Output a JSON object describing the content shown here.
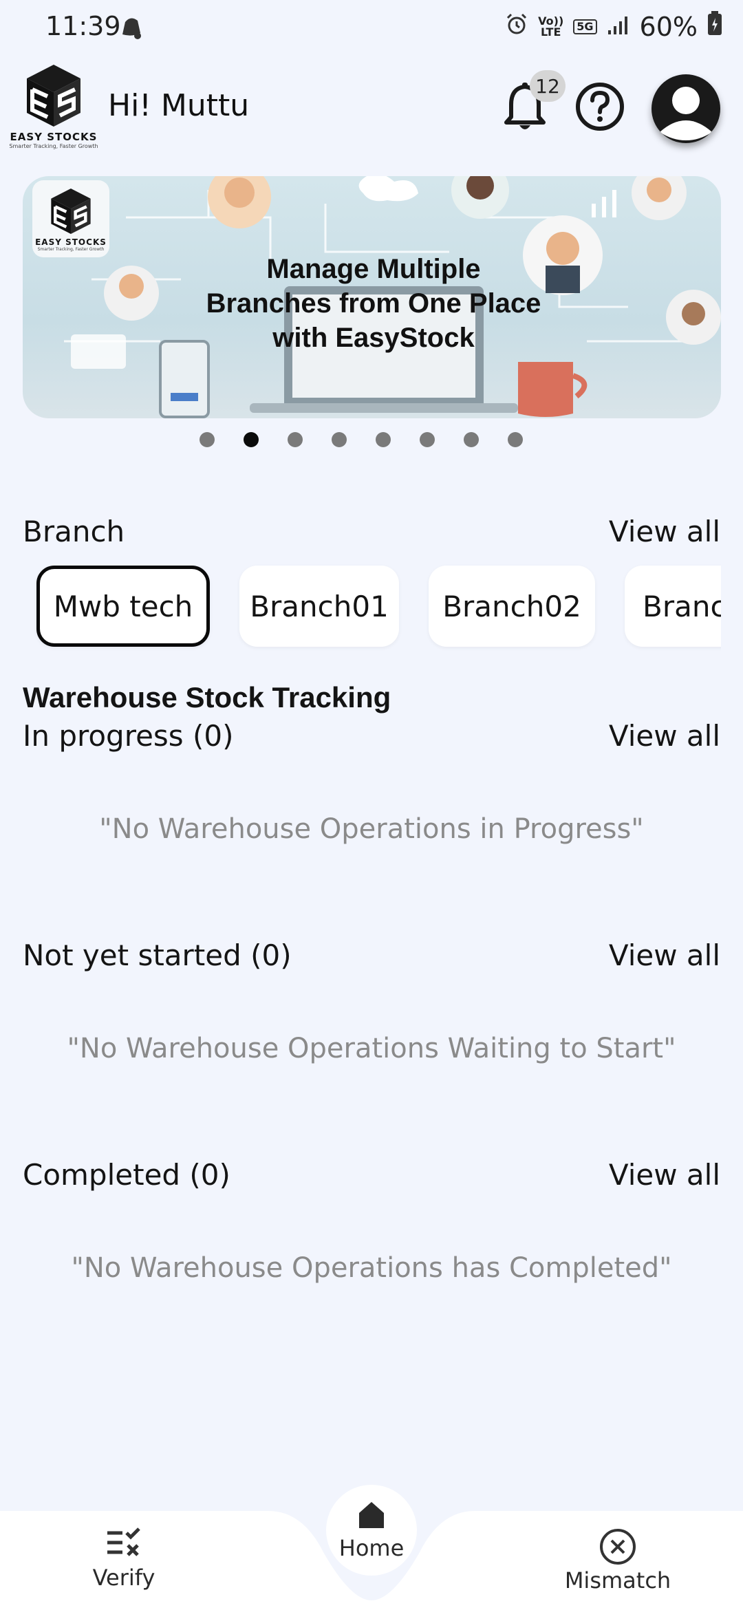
{
  "status_bar": {
    "time": "11:39",
    "volte_top": "Vo))",
    "volte_bottom": "LTE",
    "network": "5G",
    "battery": "60%"
  },
  "header": {
    "logo_text": "EASY STOCKS",
    "logo_tagline": "Smarter Tracking, Faster Growth",
    "greeting": "Hi! Muttu",
    "notification_count": "12"
  },
  "banner": {
    "title": "Manage Multiple\nBranches from One Place\nwith EasyStock",
    "logo_text": "EASY STOCKS",
    "logo_tagline": "Smarter Tracking, Faster Growth",
    "slide_count": 8,
    "active_slide": 2
  },
  "branch_section": {
    "label": "Branch",
    "view_all": "View all",
    "chips": [
      "Mwb tech",
      "Branch01",
      "Branch02",
      "Branc"
    ],
    "selected": "Mwb tech"
  },
  "warehouse": {
    "title": "Warehouse Stock Tracking",
    "in_progress": {
      "label": "In progress (0)",
      "view_all": "View all",
      "empty": "\"No Warehouse Operations in Progress\""
    },
    "not_started": {
      "label": "Not yet started (0)",
      "view_all": "View all",
      "empty": "\"No Warehouse Operations Waiting to Start\""
    },
    "completed": {
      "label": "Completed (0)",
      "view_all": "View all",
      "empty": "\"No Warehouse Operations has Completed\""
    }
  },
  "bottom_nav": {
    "verify": "Verify",
    "home": "Home",
    "mismatch": "Mismatch"
  },
  "colors": {
    "background": "#f2f5fd",
    "selected_chip_border": "#0a0a0a",
    "muted_text": "#8a8a8a"
  }
}
